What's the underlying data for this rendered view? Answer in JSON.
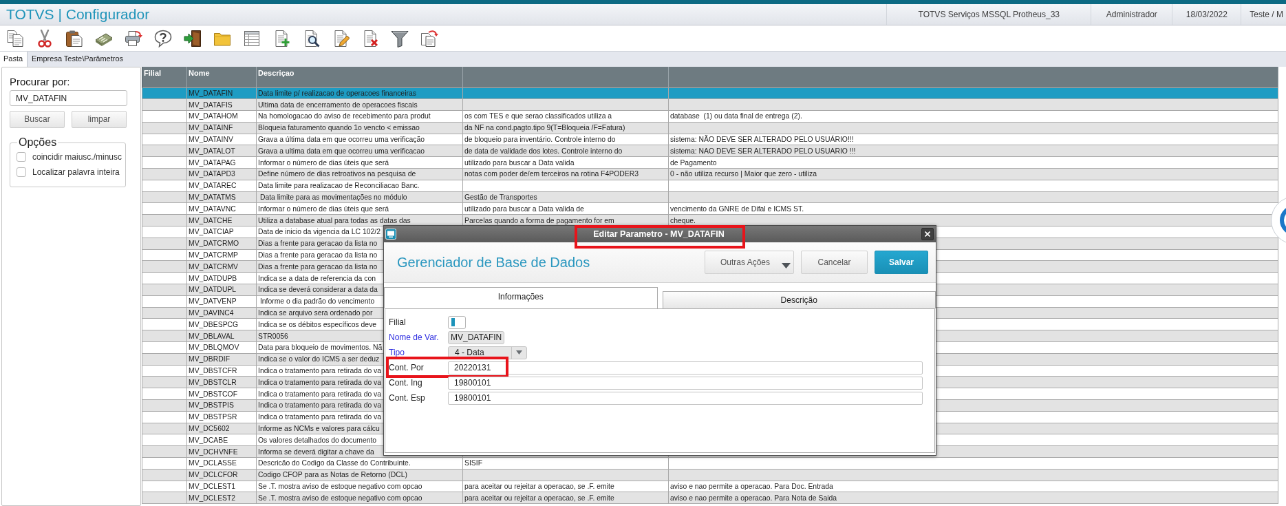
{
  "app_bar": {
    "title": "TOTVS | Configurador",
    "info": [
      "TOTVS Serviços MSSQL Protheus_33",
      "Administrador",
      "18/03/2022",
      "Teste / M"
    ]
  },
  "toolbar": [
    {
      "kind": "copy"
    },
    {
      "kind": "cut"
    },
    {
      "kind": "paste"
    },
    {
      "kind": "calculator"
    },
    {
      "kind": "print"
    },
    {
      "kind": "help"
    },
    {
      "kind": "exit"
    },
    {
      "kind": "folder"
    },
    {
      "kind": "browse"
    },
    {
      "kind": "add"
    },
    {
      "kind": "view"
    },
    {
      "kind": "edit"
    },
    {
      "kind": "delete"
    },
    {
      "kind": "filter"
    },
    {
      "kind": "reload"
    }
  ],
  "tabs": [
    {
      "label": "Pasta",
      "selected": true
    }
  ],
  "path": "Empresa Teste\\Parâmetros",
  "search_panel": {
    "title": "Procurar por:",
    "value": "MV_DATAFIN",
    "buttons": [
      "Buscar",
      "limpar"
    ],
    "options_title": "Opções",
    "options": [
      {
        "label": "coincidir maiusc./minusc",
        "checked": false
      },
      {
        "label": "Localizar palavra inteira",
        "checked": false
      }
    ]
  },
  "grid": {
    "columns": [
      "Filial",
      "Nome",
      "Descriçao"
    ],
    "rows": [
      {
        "name": "MV_DATAFIN",
        "description": "Data limite p/ realizacao de operacoes financeiras",
        "selected": true
      },
      {
        "name": "MV_DATAFIS",
        "description": "Ultima data de encerramento de operacoes fiscais",
        "selected": false
      },
      {
        "name": "MV_DATAHOM",
        "description": "Na homologacao do aviso de recebimento para produt",
        "column_4": "os com TES e que serao classificados utiliza a",
        "column_5": "database  (1) ou data final de entrega (2).",
        "selected": false
      },
      {
        "name": "MV_DATAINF",
        "description": "Bloqueia faturamento quando 1o vencto < emissao",
        "column_4": "da NF na cond.pagto.tipo 9(T=Bloqueia /F=Fatura)",
        "selected": false
      },
      {
        "name": "MV_DATAINV",
        "description": "Grava a última data em que ocorreu uma verificação",
        "column_4": "de bloqueio para inventário. Controle interno do",
        "column_5": "sistema: NÃO DEVE SER ALTERADO PELO USUÁRIO!!!",
        "selected": false
      },
      {
        "name": "MV_DATALOT",
        "description": "Grava a ultima data em que ocorreu uma verificacao",
        "column_4": "de data de validade dos lotes. Controle interno do",
        "column_5": "sistema: NAO DEVE SER ALTERADO PELO USUARIO !!!",
        "selected": false
      },
      {
        "name": "MV_DATAPAG",
        "description": "Informar o número de dias úteis que será",
        "column_4": "utilizado para buscar a Data valida",
        "column_5": "de Pagamento",
        "selected": false
      },
      {
        "name": "MV_DATAPD3",
        "description": "Define número de dias retroativos na pesquisa de",
        "column_4": "notas com poder de/em terceiros na rotina F4PODER3",
        "column_5": "0 - não utiliza recurso | Maior que zero - utiliza",
        "selected": false
      },
      {
        "name": "MV_DATAREC",
        "description": "Data limite para realizacao de Reconciliacao Banc.",
        "selected": false
      },
      {
        "name": "MV_DATATMS",
        "description": " Data limite para as movimentações no módulo",
        "column_4": "Gestão de Transportes",
        "selected": false
      },
      {
        "name": "MV_DATAVNC",
        "description": "Informar o número de dias úteis que será",
        "column_4": "utilizado para buscar a Data valida de",
        "column_5": "vencimento da GNRE de Difal e ICMS ST.",
        "selected": false
      },
      {
        "name": "MV_DATCHE",
        "description": "Utiliza a database atual para todas as datas das",
        "column_4": "Parcelas quando a forma de pagamento for em",
        "column_5": "cheque.",
        "selected": false
      },
      {
        "name": "MV_DATCIAP",
        "description": "Data de inicio da vigencia da LC 102/2",
        "selected": false
      },
      {
        "name": "MV_DATCRMO",
        "description": "Dias a frente para geracao da lista no",
        "selected": false
      },
      {
        "name": "MV_DATCRMP",
        "description": "Dias a frente para geracao da lista no",
        "selected": false
      },
      {
        "name": "MV_DATCRMV",
        "description": "Dias a frente para geracao da lista no",
        "selected": false
      },
      {
        "name": "MV_DATDUPB",
        "description": "Indica se a data de referencia da con",
        "selected": false
      },
      {
        "name": "MV_DATDUPL",
        "description": "Indica se deverá considerar a data da",
        "selected": false
      },
      {
        "name": "MV_DATVENP",
        "description": " Informe o dia padrão do vencimento",
        "selected": false
      },
      {
        "name": "MV_DAVINC4",
        "description": "Indica se arquivo sera ordenado por",
        "selected": false
      },
      {
        "name": "MV_DBESPCG",
        "description": "Indica se os débitos específicos deve",
        "selected": false
      },
      {
        "name": "MV_DBLAVAL",
        "description": "STR0056",
        "selected": false
      },
      {
        "name": "MV_DBLQMOV",
        "description": "Data para bloqueio de movimentos. Nã",
        "selected": false
      },
      {
        "name": "MV_DBRDIF",
        "description": "Indica se o valor do ICMS a ser deduz",
        "selected": false
      },
      {
        "name": "MV_DBSTCFR",
        "description": "Indica o tratamento para retirada do va",
        "selected": false
      },
      {
        "name": "MV_DBSTCLR",
        "description": "Indica o tratamento para retirada do va",
        "selected": false
      },
      {
        "name": "MV_DBSTCOF",
        "description": "Indica o tratamento para retirada do va",
        "selected": false
      },
      {
        "name": "MV_DBSTPIS",
        "description": "Indica o tratamento para retirada do va",
        "selected": false
      },
      {
        "name": "MV_DBSTPSR",
        "description": "Indica o tratamento para retirada do va",
        "selected": false
      },
      {
        "name": "MV_DC5602",
        "description": "Informe as NCMs e valores para cálcu",
        "selected": false
      },
      {
        "name": "MV_DCABE",
        "description": "Os valores detalhados do documento",
        "selected": false
      },
      {
        "name": "MV_DCHVNFE",
        "description": "Informa se deverá digitar a chave da",
        "selected": false
      },
      {
        "name": "MV_DCLASSE",
        "description": "Descricão do Codigo da Classe do Contribuinte.",
        "column_4": "SISIF",
        "selected": false
      },
      {
        "name": "MV_DCLCFOR",
        "description": "Codigo CFOP para as Notas de Retorno (DCL)",
        "selected": false
      },
      {
        "name": "MV_DCLEST1",
        "description": "Se .T. mostra aviso de estoque negativo com opcao",
        "column_4": "para aceitar ou rejeitar a operacao, se .F. emite",
        "column_5": "aviso e nao permite a operacao. Para Doc. Entrada",
        "selected": false
      },
      {
        "name": "MV_DCLEST2",
        "description": "Se .T. mostra aviso de estoque negativo com opcao",
        "column_4": "para aceitar ou rejeitar a operacao, se .F. emite",
        "column_5": "aviso e nao permite a operacao. Para Nota de Saida",
        "selected": false
      }
    ]
  },
  "dialog": {
    "title": "Editar Parametro - MV_DATAFIN",
    "title_highlighted": true,
    "heading": "Gerenciador de Base de Dados",
    "buttons": [
      {
        "label": "Outras Ações",
        "kind": "menu"
      },
      {
        "label": "Cancelar",
        "kind": "secondary"
      },
      {
        "label": "Salvar",
        "kind": "primary"
      }
    ],
    "tabs": [
      {
        "label": "Informações",
        "selected": true
      },
      {
        "label": "Descrição",
        "selected": false
      }
    ],
    "fields": [
      {
        "label": "Filial",
        "kind": "box",
        "required": false,
        "focused": true,
        "highlighted": false
      },
      {
        "label": "Nome de Var.",
        "kind": "readonly",
        "value": "MV_DATAFIN",
        "required": true,
        "focused": false,
        "highlighted": false
      },
      {
        "label": "Tipo",
        "kind": "select",
        "value": "4 - Data",
        "required": true,
        "focused": false,
        "highlighted": false
      },
      {
        "label": "Cont. Por",
        "kind": "text",
        "value": "20220131",
        "required": false,
        "focused": false,
        "highlighted": true
      },
      {
        "label": "Cont. Ing",
        "kind": "text",
        "value": "19800101",
        "required": false,
        "focused": false,
        "highlighted": false
      },
      {
        "label": "Cont. Esp",
        "kind": "text",
        "value": "19800101",
        "required": false,
        "focused": false,
        "highlighted": false
      }
    ]
  }
}
